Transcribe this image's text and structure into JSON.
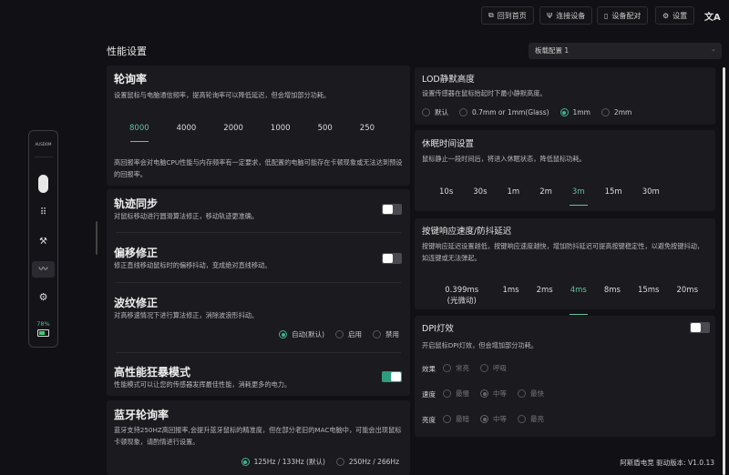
{
  "header": {
    "buttons": [
      {
        "label": "回到首页",
        "icon": "home-icon"
      },
      {
        "label": "连接设备",
        "icon": "signal-icon"
      },
      {
        "label": "设备配对",
        "icon": "mouse-icon"
      },
      {
        "label": "设置",
        "icon": "gear-icon"
      }
    ],
    "translate_icon": "文A"
  },
  "page_title": "性能设置",
  "profile_select": {
    "value": "板载配置 1"
  },
  "sidebar": {
    "brand": "AUSDOM",
    "battery": "78%"
  },
  "polling": {
    "title": "轮询率",
    "desc": "设置鼠标与电脑通信频率，提高轮询率可以降低延迟，但会增加部分功耗。",
    "options": [
      "8000",
      "4000",
      "2000",
      "1000",
      "500",
      "250"
    ],
    "selected": "8000",
    "note": "高回报率会对电脑CPU性能与内存频率有一定要求，低配置的电脑可能存在卡顿现象或无法达到预设的回报率。"
  },
  "track_sync": {
    "title": "轨迹同步",
    "desc": "对鼠标移动进行圆滑算法修正，移动轨迹更准确。",
    "enabled": false
  },
  "offset_fix": {
    "title": "偏移修正",
    "desc": "修正直线移动鼠标时的偏移抖动，变成绝对直线移动。",
    "enabled": false
  },
  "ripple_fix": {
    "title": "波纹修正",
    "desc": "对高移速情况下进行算法修正，消除波浪形抖动。",
    "options": [
      "自动(默认)",
      "启用",
      "禁用"
    ],
    "selected": "自动(默认)"
  },
  "turbo": {
    "title": "高性能狂暴模式",
    "desc": "性能模式可以让您的传感器发挥最佳性能，消耗更多的电力。",
    "enabled": true
  },
  "bt_polling": {
    "title": "蓝牙轮询率",
    "desc": "蓝牙支持250HZ高回报率,会提升蓝牙鼠标的精准度，但在部分老旧的MAC电脑中，可能会出现鼠标卡顿现象，请酌情进行设置。",
    "options": [
      "125Hz / 133Hz (默认)",
      "250Hz / 266Hz"
    ],
    "selected": "125Hz / 133Hz (默认)"
  },
  "lod": {
    "title": "LOD静默高度",
    "desc": "设置传感器在鼠标抬起时下最小静默高度。",
    "options": [
      "默认",
      "0.7mm or 1mm(Glass)",
      "1mm",
      "2mm"
    ],
    "selected": "1mm"
  },
  "sleep": {
    "title": "休眠时间设置",
    "desc": "鼠标静止一段时间后，将进入休眠状态，降低鼠标功耗。",
    "options": [
      "10s",
      "30s",
      "1m",
      "2m",
      "3m",
      "15m",
      "30m"
    ],
    "selected": "3m"
  },
  "debounce": {
    "title": "按键响应速度/防抖延迟",
    "desc": "按键响应延迟设置越低，按键响应速度越快，增加防抖延迟可提高按键稳定性，以避免按键抖动，如连键或无法弹起。",
    "options": [
      "0.399ms (光微动)",
      "1ms",
      "2ms",
      "4ms",
      "8ms",
      "15ms",
      "20ms"
    ],
    "selected": "4ms"
  },
  "dpi_light": {
    "title": "DPI灯效",
    "desc": "开启鼠标DPI灯效，但会增加部分功耗。",
    "enabled": false,
    "rows": [
      {
        "label": "效果",
        "options": [
          "常亮",
          "呼吸"
        ],
        "selected": ""
      },
      {
        "label": "速度",
        "options": [
          "最慢",
          "中等",
          "最快"
        ],
        "selected": "中等"
      },
      {
        "label": "亮度",
        "options": [
          "最暗",
          "中等",
          "最亮"
        ],
        "selected": "中等"
      }
    ]
  },
  "footer": {
    "version": "阿斯盾电竞 驱动版本: V1.0.13"
  },
  "colors": {
    "accent": "#2e9c7c",
    "accent_text": "#63c29c",
    "card": "#1a1a1f",
    "bg": "#111115"
  }
}
